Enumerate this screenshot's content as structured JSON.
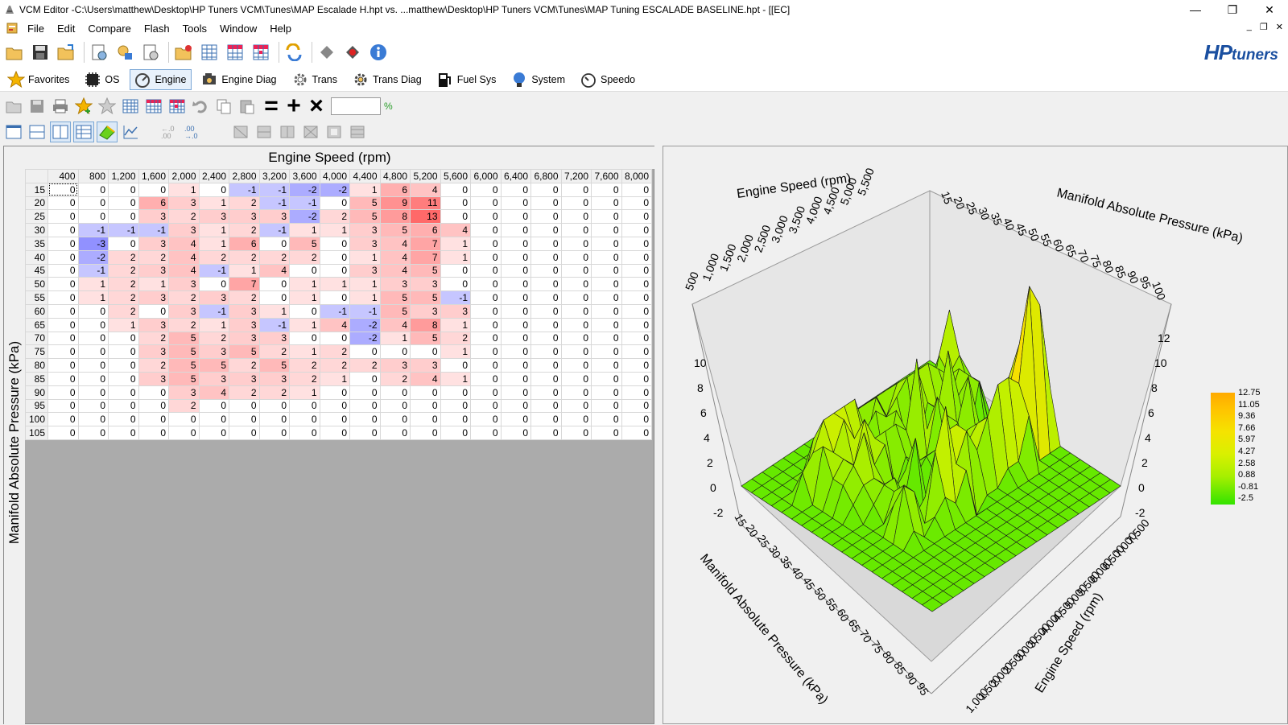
{
  "window": {
    "title": "VCM Editor -C:\\Users\\matthew\\Desktop\\HP Tuners VCM\\Tunes\\MAP Escalade H.hpt vs. ...matthew\\Desktop\\HP Tuners VCM\\Tunes\\MAP Tuning ESCALADE BASELINE.hpt - [[EC]",
    "minimize": "—",
    "restore": "❐",
    "close": "✕"
  },
  "menu": {
    "items": [
      "File",
      "Edit",
      "Compare",
      "Flash",
      "Tools",
      "Window",
      "Help"
    ],
    "mdi_min": "_",
    "mdi_restore": "❐",
    "mdi_close": "✕"
  },
  "brand": {
    "hp": "HP",
    "tuners": "tuners"
  },
  "nav": {
    "items": [
      "Favorites",
      "OS",
      "Engine",
      "Engine Diag",
      "Trans",
      "Trans Diag",
      "Fuel Sys",
      "System",
      "Speedo"
    ],
    "active": "Engine"
  },
  "editbar": {
    "value": "",
    "unit": "%",
    "op_equals": "=",
    "op_plus": "+",
    "op_times": "×"
  },
  "table": {
    "x_title": "Engine Speed (rpm)",
    "y_title": "Manifold Absolute Pressure (kPa)",
    "columns": [
      "400",
      "800",
      "1,200",
      "1,600",
      "2,000",
      "2,400",
      "2,800",
      "3,200",
      "3,600",
      "4,000",
      "4,400",
      "4,800",
      "5,200",
      "5,600",
      "6,000",
      "6,400",
      "6,800",
      "7,200",
      "7,600",
      "8,000"
    ],
    "rows": [
      {
        "kpa": "15",
        "v": [
          0,
          0,
          0,
          0,
          1,
          0,
          -1,
          -1,
          -2,
          -2,
          1,
          6,
          4,
          0,
          0,
          0,
          0,
          0,
          0,
          0
        ]
      },
      {
        "kpa": "20",
        "v": [
          0,
          0,
          0,
          6,
          3,
          1,
          2,
          -1,
          -1,
          0,
          5,
          9,
          11,
          0,
          0,
          0,
          0,
          0,
          0,
          0
        ]
      },
      {
        "kpa": "25",
        "v": [
          0,
          0,
          0,
          3,
          2,
          3,
          3,
          3,
          -2,
          2,
          5,
          8,
          13,
          0,
          0,
          0,
          0,
          0,
          0,
          0
        ]
      },
      {
        "kpa": "30",
        "v": [
          0,
          -1,
          -1,
          -1,
          3,
          1,
          2,
          -1,
          1,
          1,
          3,
          5,
          6,
          4,
          0,
          0,
          0,
          0,
          0,
          0
        ]
      },
      {
        "kpa": "35",
        "v": [
          0,
          -3,
          0,
          3,
          4,
          1,
          6,
          0,
          5,
          0,
          3,
          4,
          7,
          1,
          0,
          0,
          0,
          0,
          0,
          0
        ]
      },
      {
        "kpa": "40",
        "v": [
          0,
          -2,
          2,
          2,
          4,
          2,
          2,
          2,
          2,
          0,
          1,
          4,
          7,
          1,
          0,
          0,
          0,
          0,
          0,
          0
        ]
      },
      {
        "kpa": "45",
        "v": [
          0,
          -1,
          2,
          3,
          4,
          -1,
          1,
          4,
          0,
          0,
          3,
          4,
          5,
          0,
          0,
          0,
          0,
          0,
          0,
          0
        ]
      },
      {
        "kpa": "50",
        "v": [
          0,
          1,
          2,
          1,
          3,
          0,
          7,
          0,
          1,
          1,
          1,
          3,
          3,
          0,
          0,
          0,
          0,
          0,
          0,
          0
        ]
      },
      {
        "kpa": "55",
        "v": [
          0,
          1,
          2,
          3,
          2,
          3,
          2,
          0,
          1,
          0,
          1,
          5,
          5,
          -1,
          0,
          0,
          0,
          0,
          0,
          0
        ]
      },
      {
        "kpa": "60",
        "v": [
          0,
          0,
          2,
          0,
          3,
          -1,
          3,
          1,
          0,
          -1,
          -1,
          5,
          3,
          3,
          0,
          0,
          0,
          0,
          0,
          0
        ]
      },
      {
        "kpa": "65",
        "v": [
          0,
          0,
          1,
          3,
          2,
          1,
          3,
          -1,
          1,
          4,
          -2,
          4,
          8,
          1,
          0,
          0,
          0,
          0,
          0,
          0
        ]
      },
      {
        "kpa": "70",
        "v": [
          0,
          0,
          0,
          2,
          5,
          2,
          3,
          3,
          0,
          0,
          -2,
          1,
          5,
          2,
          0,
          0,
          0,
          0,
          0,
          0
        ]
      },
      {
        "kpa": "75",
        "v": [
          0,
          0,
          0,
          3,
          5,
          3,
          5,
          2,
          1,
          2,
          0,
          0,
          0,
          1,
          0,
          0,
          0,
          0,
          0,
          0
        ]
      },
      {
        "kpa": "80",
        "v": [
          0,
          0,
          0,
          2,
          5,
          5,
          2,
          5,
          2,
          2,
          2,
          3,
          3,
          0,
          0,
          0,
          0,
          0,
          0,
          0
        ]
      },
      {
        "kpa": "85",
        "v": [
          0,
          0,
          0,
          3,
          5,
          3,
          3,
          3,
          2,
          1,
          0,
          2,
          4,
          1,
          0,
          0,
          0,
          0,
          0,
          0
        ]
      },
      {
        "kpa": "90",
        "v": [
          0,
          0,
          0,
          0,
          3,
          4,
          2,
          2,
          1,
          0,
          0,
          0,
          0,
          0,
          0,
          0,
          0,
          0,
          0,
          0
        ]
      },
      {
        "kpa": "95",
        "v": [
          0,
          0,
          0,
          0,
          2,
          0,
          0,
          0,
          0,
          0,
          0,
          0,
          0,
          0,
          0,
          0,
          0,
          0,
          0,
          0
        ]
      },
      {
        "kpa": "100",
        "v": [
          0,
          0,
          0,
          0,
          0,
          0,
          0,
          0,
          0,
          0,
          0,
          0,
          0,
          0,
          0,
          0,
          0,
          0,
          0,
          0
        ]
      },
      {
        "kpa": "105",
        "v": [
          0,
          0,
          0,
          0,
          0,
          0,
          0,
          0,
          0,
          0,
          0,
          0,
          0,
          0,
          0,
          0,
          0,
          0,
          0,
          0
        ]
      }
    ],
    "colors": {
      "positive": "#f26b6b",
      "negative": "#7b7bf0"
    }
  },
  "plot3d": {
    "x_axis_label_top": "Engine Speed (rpm)",
    "y_axis_label_top": "Manifold Absolute Pressure (kPa)",
    "x_axis_label_bottom": "Engine Speed (rpm)",
    "y_axis_label_bottom": "Manifold Absolute Pressure (kPa)",
    "top_rpm_ticks": [
      "500",
      "1,000",
      "1,500",
      "2,000",
      "2,500",
      "3,000",
      "3,500",
      "4,000",
      "4,500",
      "5,000",
      "5,500"
    ],
    "top_kpa_ticks": [
      "15",
      "20",
      "25",
      "30",
      "35",
      "40",
      "45",
      "50",
      "55",
      "60",
      "65",
      "70",
      "75",
      "80",
      "85",
      "90",
      "95",
      "100"
    ],
    "z_ticks_left": [
      "-2",
      "0",
      "2",
      "4",
      "6",
      "8",
      "10"
    ],
    "z_ticks_right": [
      "-2",
      "0",
      "2",
      "4",
      "6",
      "8",
      "10",
      "12"
    ],
    "bottom_kpa_ticks": [
      "15",
      "20",
      "25",
      "30",
      "35",
      "40",
      "45",
      "50",
      "55",
      "60",
      "65",
      "70",
      "75",
      "80",
      "85",
      "90",
      "95"
    ],
    "bottom_rpm_ticks": [
      "1,000",
      "1,500",
      "2,000",
      "2,500",
      "3,000",
      "3,500",
      "4,000",
      "4,500",
      "5,000",
      "5,500",
      "6,000",
      "6,500",
      "7,000",
      "7,500"
    ],
    "legend": [
      "12.75",
      "11.05",
      "9.36",
      "7.66",
      "5.97",
      "4.27",
      "2.58",
      "0.88",
      "-0.81",
      "-2.5"
    ]
  }
}
